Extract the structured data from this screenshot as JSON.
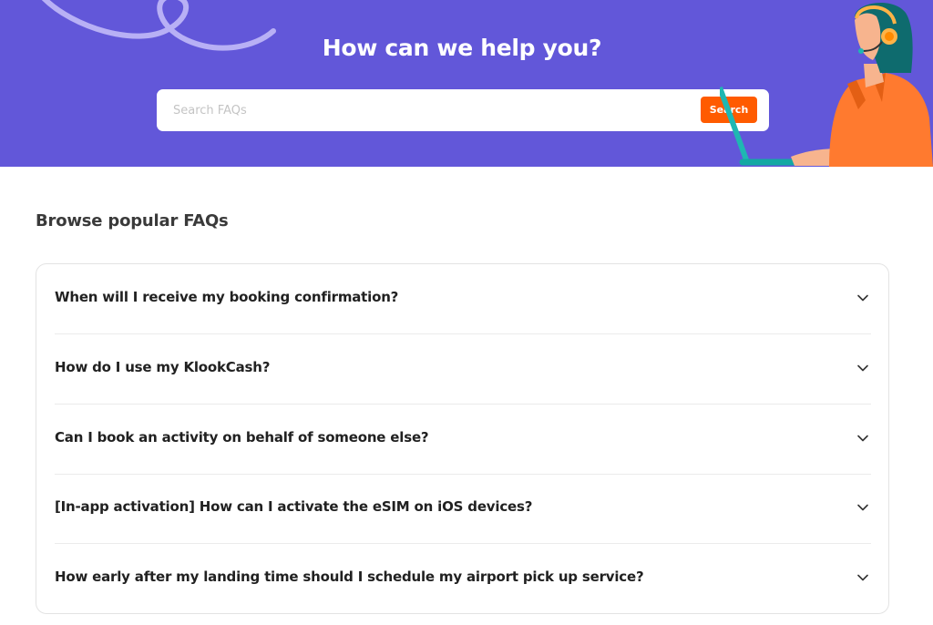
{
  "hero": {
    "title": "How can we help you?",
    "search": {
      "placeholder": "Search FAQs",
      "value": "",
      "button_label": "Search"
    }
  },
  "faq_section": {
    "title": "Browse popular FAQs",
    "items": [
      {
        "question": "When will I receive my booking confirmation?",
        "icon": "chevron-down-icon"
      },
      {
        "question": "How do I use my KlookCash?",
        "icon": "chevron-down-icon"
      },
      {
        "question": "Can I book an activity on behalf of someone else?",
        "icon": "chevron-down-icon"
      },
      {
        "question": "[In-app activation] How can I activate the eSIM on iOS devices?",
        "icon": "chevron-down-icon"
      },
      {
        "question": "How early after my landing time should I schedule my airport pick up service?",
        "icon": "chevron-down-icon"
      }
    ]
  },
  "colors": {
    "hero_background": "#6257d9",
    "accent": "#ff5b00",
    "text": "#212121"
  }
}
